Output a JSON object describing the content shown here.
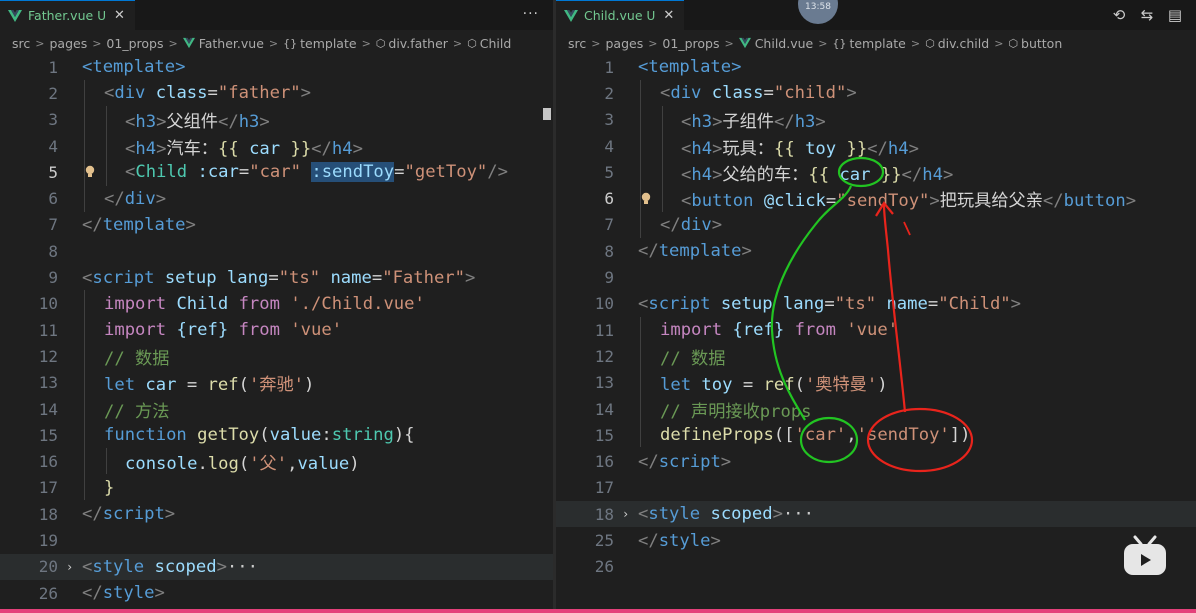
{
  "left": {
    "tab": {
      "label": "Father.vue",
      "modified": "U",
      "close": "✕"
    },
    "more": "···",
    "breadcrumb": [
      "src",
      "pages",
      "01_props",
      "Father.vue",
      "template",
      "div.father",
      "Child"
    ],
    "lines": [
      {
        "n": "1"
      },
      {
        "n": "2"
      },
      {
        "n": "3"
      },
      {
        "n": "4"
      },
      {
        "n": "5"
      },
      {
        "n": "6"
      },
      {
        "n": "7"
      },
      {
        "n": "8"
      },
      {
        "n": "9"
      },
      {
        "n": "10"
      },
      {
        "n": "11"
      },
      {
        "n": "12"
      },
      {
        "n": "13"
      },
      {
        "n": "14"
      },
      {
        "n": "15"
      },
      {
        "n": "16"
      },
      {
        "n": "17"
      },
      {
        "n": "18"
      },
      {
        "n": "19"
      },
      {
        "n": "20"
      },
      {
        "n": "26"
      }
    ],
    "code": {
      "l1": "<template>",
      "l2_tag": "div",
      "l2_attr": "class",
      "l2_val": "\"father\"",
      "l3_tag": "h3",
      "l3_text": "父组件",
      "l4_tag": "h4",
      "l4_text": "汽车：",
      "l4_mus_open": "{{",
      "l4_var": "car",
      "l4_mus_close": "}}",
      "l5_tag": "Child",
      "l5_a1": ":car",
      "l5_v1": "\"car\"",
      "l5_a2": ":sendToy",
      "l5_v2": "\"getToy\"",
      "l6_tag": "div",
      "l7_tag": "template",
      "l9_tag": "script",
      "l9_a1": "setup",
      "l9_a2": "lang",
      "l9_v2": "\"ts\"",
      "l9_a3": "name",
      "l9_v3": "\"Father\"",
      "l10_kw": "import",
      "l10_name": "Child",
      "l10_from": "from",
      "l10_path": "'./Child.vue'",
      "l11_kw": "import",
      "l11_name": "{ref}",
      "l11_from": "from",
      "l11_path": "'vue'",
      "l12": "// 数据",
      "l13_kw": "let",
      "l13_var": "car",
      "l13_fn": "ref",
      "l13_str": "'奔驰'",
      "l14": "// 方法",
      "l15_kw": "function",
      "l15_fn": "getToy",
      "l15_param": "value",
      "l15_type": "string",
      "l16_obj": "console",
      "l16_fn": "log",
      "l16_str": "'父'",
      "l16_var": "value",
      "l17": "}",
      "l18_tag": "script",
      "l20_tag": "style",
      "l20_attr": "scoped",
      "l20_fold": "···",
      "l26_tag": "style"
    }
  },
  "right": {
    "tab": {
      "label": "Child.vue",
      "modified": "U",
      "close": "✕"
    },
    "breadcrumb": [
      "src",
      "pages",
      "01_props",
      "Child.vue",
      "template",
      "div.child",
      "button"
    ],
    "lines": [
      {
        "n": "1"
      },
      {
        "n": "2"
      },
      {
        "n": "3"
      },
      {
        "n": "4"
      },
      {
        "n": "5"
      },
      {
        "n": "6"
      },
      {
        "n": "7"
      },
      {
        "n": "8"
      },
      {
        "n": "9"
      },
      {
        "n": "10"
      },
      {
        "n": "11"
      },
      {
        "n": "12"
      },
      {
        "n": "13"
      },
      {
        "n": "14"
      },
      {
        "n": "15"
      },
      {
        "n": "16"
      },
      {
        "n": "17"
      },
      {
        "n": "18"
      },
      {
        "n": "25"
      },
      {
        "n": "26"
      }
    ],
    "code": {
      "l1": "<template>",
      "l2_tag": "div",
      "l2_attr": "class",
      "l2_val": "\"child\"",
      "l3_tag": "h3",
      "l3_text": "子组件",
      "l4_tag": "h4",
      "l4_text": "玩具：",
      "l4_var": "toy",
      "l5_tag": "h4",
      "l5_text": "父给的车：",
      "l5_var": "car",
      "l6_tag": "button",
      "l6_attr": "@click",
      "l6_val": "\"sendToy\"",
      "l6_text": "把玩具给父亲",
      "l7_tag": "div",
      "l8_tag": "template",
      "l10_tag": "script",
      "l10_a1": "setup",
      "l10_a2": "lang",
      "l10_v2": "\"ts\"",
      "l10_a3": "name",
      "l10_v3": "\"Child\"",
      "l11_kw": "import",
      "l11_name": "{ref}",
      "l11_from": "from",
      "l11_path": "'vue'",
      "l12": "// 数据",
      "l13_kw": "let",
      "l13_var": "toy",
      "l13_fn": "ref",
      "l13_str": "'奥特曼'",
      "l14": "// 声明接收props",
      "l15_fn": "defineProps",
      "l15_s1": "'car'",
      "l15_s2": "'sendToy'",
      "l16_tag": "script",
      "l18_tag": "style",
      "l18_attr": "scoped",
      "l18_fold": "···",
      "l25_tag": "style"
    }
  },
  "clock": "13:58",
  "colors": {
    "annotation_green": "#22c422",
    "annotation_red": "#e8241c",
    "accent": "#0078d4"
  }
}
